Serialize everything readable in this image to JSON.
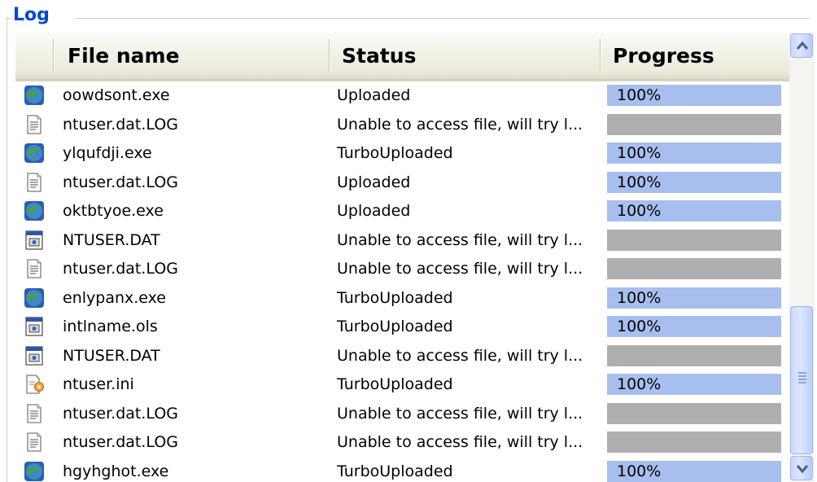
{
  "group": {
    "title": "Log"
  },
  "columns": [
    "File name",
    "Status",
    "Progress"
  ],
  "rows": [
    {
      "icon": "globe-exe-icon",
      "name": "oowdsont.exe",
      "status": "Uploaded",
      "progress": "100%",
      "progress_value": 1.0
    },
    {
      "icon": "text-document-icon",
      "name": "ntuser.dat.LOG",
      "status": "Unable to access file, will try l...",
      "progress": "",
      "progress_value": 0
    },
    {
      "icon": "globe-exe-icon",
      "name": "ylqufdji.exe",
      "status": "TurboUploaded",
      "progress": "100%",
      "progress_value": 1.0
    },
    {
      "icon": "text-document-icon",
      "name": "ntuser.dat.LOG",
      "status": "Uploaded",
      "progress": "100%",
      "progress_value": 1.0
    },
    {
      "icon": "globe-exe-icon",
      "name": "oktbtyoe.exe",
      "status": "Uploaded",
      "progress": "100%",
      "progress_value": 1.0
    },
    {
      "icon": "system-file-icon",
      "name": "NTUSER.DAT",
      "status": "Unable to access file, will try l...",
      "progress": "",
      "progress_value": 0
    },
    {
      "icon": "text-document-icon",
      "name": "ntuser.dat.LOG",
      "status": "Unable to access file, will try l...",
      "progress": "",
      "progress_value": 0
    },
    {
      "icon": "globe-exe-icon",
      "name": "enlypanx.exe",
      "status": "TurboUploaded",
      "progress": "100%",
      "progress_value": 1.0
    },
    {
      "icon": "system-file-icon",
      "name": "intlname.ols",
      "status": "TurboUploaded",
      "progress": "100%",
      "progress_value": 1.0
    },
    {
      "icon": "system-file-icon",
      "name": "NTUSER.DAT",
      "status": "Unable to access file, will try l...",
      "progress": "",
      "progress_value": 0
    },
    {
      "icon": "settings-file-icon",
      "name": "ntuser.ini",
      "status": "TurboUploaded",
      "progress": "100%",
      "progress_value": 1.0
    },
    {
      "icon": "text-document-icon",
      "name": "ntuser.dat.LOG",
      "status": "Unable to access file, will try l...",
      "progress": "",
      "progress_value": 0
    },
    {
      "icon": "text-document-icon",
      "name": "ntuser.dat.LOG",
      "status": "Unable to access file, will try l...",
      "progress": "",
      "progress_value": 0
    },
    {
      "icon": "globe-exe-icon",
      "name": "hgyhghot.exe",
      "status": "TurboUploaded",
      "progress": "100%",
      "progress_value": 1.0
    }
  ],
  "scrollbar": {
    "up_icon": "arrow-up-icon",
    "down_icon": "arrow-down-icon",
    "grip_icon": "grip-icon"
  },
  "colors": {
    "title": "#0046d5",
    "progress_done": "#a7bfef",
    "progress_none": "#afafaf"
  }
}
